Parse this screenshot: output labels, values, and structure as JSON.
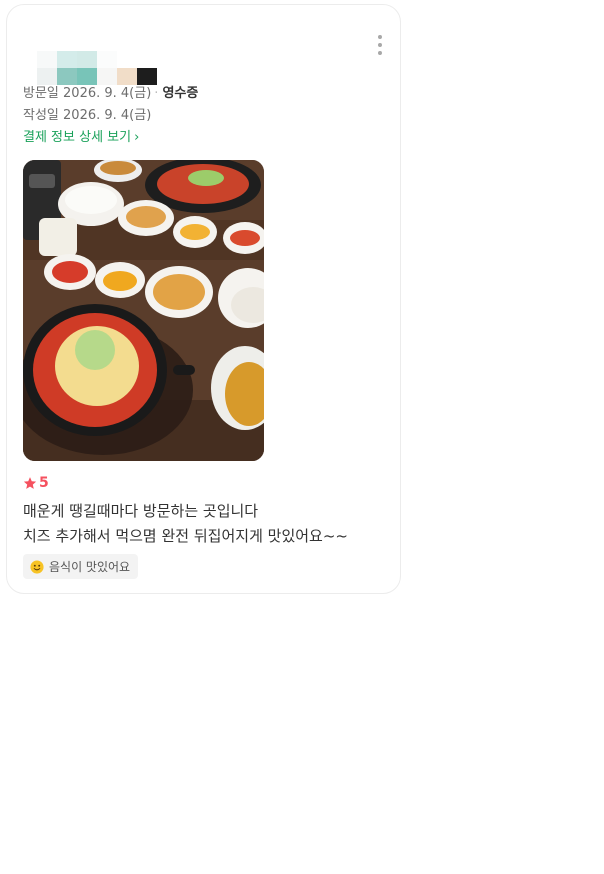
{
  "review": {
    "visit_label": "방문일",
    "visit_date": "2026. 9. 4(금)",
    "separator": "·",
    "receipt_label": "영수증",
    "written_label": "작성일",
    "written_date": "2026. 9. 4(금)",
    "detail_link": "결제 정보 상세 보기",
    "rating": "5",
    "text_lines": [
      "매운게 땡길때마다 방문하는 곳입니다",
      "치즈 추가해서 먹으몀 완전 뒤집어지게 맛있어요~~"
    ],
    "tag_label": "음식이 맛있어요"
  },
  "icons": {
    "more": "more-vertical-icon",
    "chevron": "chevron-right-icon",
    "star": "star-icon",
    "emoji": "smiley-emoji-icon"
  },
  "colors": {
    "link_green": "#1aa15a",
    "rating_red": "#f5515f"
  }
}
